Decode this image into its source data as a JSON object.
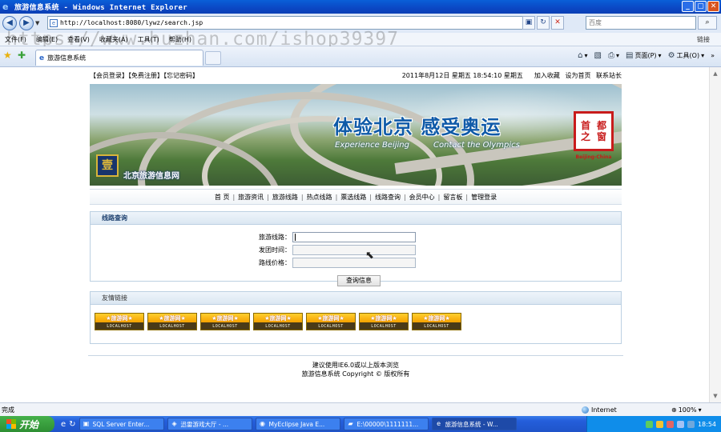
{
  "window": {
    "title": "旅游信息系统 - Windows Internet Explorer",
    "min": "_",
    "max": "▢",
    "close": "✕"
  },
  "address": {
    "url": "http://localhost:8080/lywz/search.jsp",
    "search_placeholder": "百度"
  },
  "menu": {
    "items": [
      "文件(F)",
      "编辑(E)",
      "查看(V)",
      "收藏夹(A)",
      "工具(T)",
      "帮助(H)"
    ],
    "links_label": "链接",
    "watermark": "https://www.huzhan.com/ishop39397"
  },
  "tabs": [
    {
      "label": "旅游信息系统"
    }
  ],
  "commandbar": {
    "page": "页面(P)",
    "tools": "工具(O)"
  },
  "site": {
    "top_left": "【会员登录】【免费注册】【忘记密码】",
    "datetime": "2011年8月12日  星期五  18:54:10   星期五",
    "actions": [
      "加入收藏",
      "设为首页",
      "联系站长"
    ],
    "banner": {
      "title": "体验北京 感受奥运",
      "subtitle_left": "Experience Beijing",
      "subtitle_right": "Contact the Olympics",
      "seal_chars": [
        "首",
        "都",
        "之",
        "窗"
      ],
      "seal_caption": "Beijing-China",
      "logo_text": "北京旅游信息网",
      "emblem": "壹"
    },
    "nav": [
      "首 页",
      "旅游资讯",
      "旅游线路",
      "热点线路",
      "票选线路",
      "线路查询",
      "会员中心",
      "留言板",
      "管理登录"
    ],
    "search_panel": {
      "title": "线路查询",
      "fields": [
        {
          "label": "旅游线路：",
          "value": ""
        },
        {
          "label": "发团时间：",
          "value": ""
        },
        {
          "label": "路线价格：",
          "value": ""
        }
      ],
      "submit_label": "查询信息"
    },
    "links_panel": {
      "title": "友情链接",
      "badge_top": "★旅游网★",
      "badge_bottom": "LOCALHOST",
      "count_labels": [
        "1",
        "2",
        "3",
        "4",
        "5",
        "6",
        "7"
      ]
    },
    "footer": [
      "建议使用IE6.0或以上版本浏览",
      "旅游信息系统 Copyright © 版权所有"
    ]
  },
  "status": {
    "text": "完成",
    "zone": "Internet",
    "zoom": "100%"
  },
  "taskbar": {
    "start": "开始",
    "tasks": [
      {
        "label": "SQL Server Enter...",
        "active": false
      },
      {
        "label": "迅雷游戏大厅 - ...",
        "active": false
      },
      {
        "label": "MyEclipse Java E...",
        "active": false
      },
      {
        "label": "E:\\00000\\1111111...",
        "active": false
      },
      {
        "label": "旅游信息系统 - W...",
        "active": true
      }
    ],
    "clock": "18:54"
  },
  "colors": {
    "title_blue": "#0b47c4",
    "accent": "#1c3f6e",
    "badge_gold": "#f5a200",
    "start_green": "#2e8f33"
  }
}
